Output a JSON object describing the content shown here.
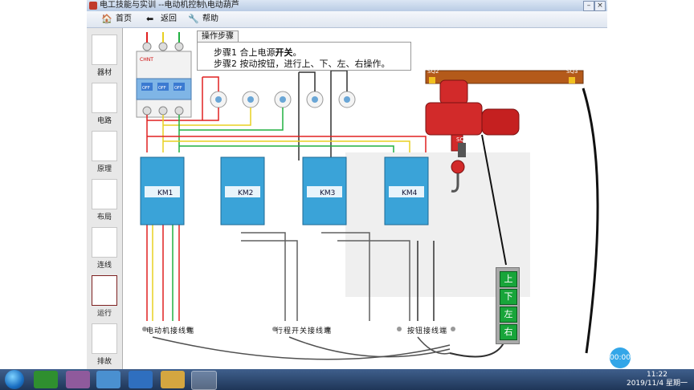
{
  "window": {
    "title": "电工技能与实训 --电动机控制\\电动葫芦"
  },
  "toolbar": {
    "home_label": "首页",
    "back_label": "返回",
    "help_label": "帮助"
  },
  "sidebar": {
    "items": [
      {
        "label": "器材"
      },
      {
        "label": "电路"
      },
      {
        "label": "原理"
      },
      {
        "label": "布局"
      },
      {
        "label": "连线"
      },
      {
        "label": "运行"
      },
      {
        "label": "排故"
      }
    ]
  },
  "steps": {
    "tab_label": "操作步骤",
    "step1_prefix": "步骤1  合上电源",
    "step1_bold": "开关",
    "step1_suffix": "。",
    "step2": "步骤2  按动按钮，进行上、下、左、右操作。"
  },
  "breaker": {
    "brand": "CHNT",
    "labels": [
      "OFF",
      "OFF",
      "OFF"
    ]
  },
  "contactors": [
    {
      "label": "KM1"
    },
    {
      "label": "KM2"
    },
    {
      "label": "KM3"
    },
    {
      "label": "KM4"
    }
  ],
  "terminals": {
    "motor_label": "电动机接线端",
    "switch_label": "行程开关接线端",
    "button_label": "按钮接线端"
  },
  "hoist": {
    "switch_labels": [
      "SQ2",
      "SQ3",
      "SQ1"
    ]
  },
  "control_buttons": [
    "上",
    "下",
    "左",
    "右"
  ],
  "timer": {
    "value": "00:00"
  },
  "taskbar": {
    "time": "11:22",
    "date": "2019/11/4 星期一"
  },
  "colors": {
    "wire_red": "#e02020",
    "wire_yellow": "#e8d020",
    "wire_green": "#20b040",
    "wire_black": "#303030",
    "contactor": "#3aa3d8",
    "button_green": "#18a53a"
  }
}
